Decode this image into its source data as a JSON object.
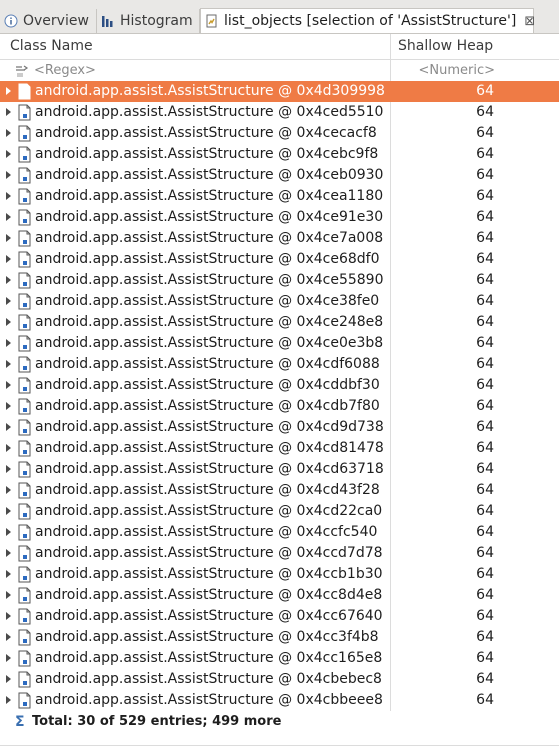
{
  "tabs": [
    {
      "label": "Overview",
      "icon": "info-icon",
      "active": false
    },
    {
      "label": "Histogram",
      "icon": "histogram-icon",
      "active": false
    },
    {
      "label": "list_objects [selection of 'AssistStructure']",
      "icon": "list-objects-icon",
      "active": true,
      "close": "⊠"
    }
  ],
  "columns": {
    "class_name": "Class Name",
    "shallow_heap": "Shallow Heap"
  },
  "filters": {
    "regex": "<Regex>",
    "numeric": "<Numeric>"
  },
  "rows": [
    {
      "name": "android.app.assist.AssistStructure @ 0x4d309998",
      "heap": "64"
    },
    {
      "name": "android.app.assist.AssistStructure @ 0x4ced5510",
      "heap": "64"
    },
    {
      "name": "android.app.assist.AssistStructure @ 0x4cecacf8",
      "heap": "64"
    },
    {
      "name": "android.app.assist.AssistStructure @ 0x4cebc9f8",
      "heap": "64"
    },
    {
      "name": "android.app.assist.AssistStructure @ 0x4ceb0930",
      "heap": "64"
    },
    {
      "name": "android.app.assist.AssistStructure @ 0x4cea1180",
      "heap": "64"
    },
    {
      "name": "android.app.assist.AssistStructure @ 0x4ce91e30",
      "heap": "64"
    },
    {
      "name": "android.app.assist.AssistStructure @ 0x4ce7a008",
      "heap": "64"
    },
    {
      "name": "android.app.assist.AssistStructure @ 0x4ce68df0",
      "heap": "64"
    },
    {
      "name": "android.app.assist.AssistStructure @ 0x4ce55890",
      "heap": "64"
    },
    {
      "name": "android.app.assist.AssistStructure @ 0x4ce38fe0",
      "heap": "64"
    },
    {
      "name": "android.app.assist.AssistStructure @ 0x4ce248e8",
      "heap": "64"
    },
    {
      "name": "android.app.assist.AssistStructure @ 0x4ce0e3b8",
      "heap": "64"
    },
    {
      "name": "android.app.assist.AssistStructure @ 0x4cdf6088",
      "heap": "64"
    },
    {
      "name": "android.app.assist.AssistStructure @ 0x4cddbf30",
      "heap": "64"
    },
    {
      "name": "android.app.assist.AssistStructure @ 0x4cdb7f80",
      "heap": "64"
    },
    {
      "name": "android.app.assist.AssistStructure @ 0x4cd9d738",
      "heap": "64"
    },
    {
      "name": "android.app.assist.AssistStructure @ 0x4cd81478",
      "heap": "64"
    },
    {
      "name": "android.app.assist.AssistStructure @ 0x4cd63718",
      "heap": "64"
    },
    {
      "name": "android.app.assist.AssistStructure @ 0x4cd43f28",
      "heap": "64"
    },
    {
      "name": "android.app.assist.AssistStructure @ 0x4cd22ca0",
      "heap": "64"
    },
    {
      "name": "android.app.assist.AssistStructure @ 0x4ccfc540",
      "heap": "64"
    },
    {
      "name": "android.app.assist.AssistStructure @ 0x4ccd7d78",
      "heap": "64"
    },
    {
      "name": "android.app.assist.AssistStructure @ 0x4ccb1b30",
      "heap": "64"
    },
    {
      "name": "android.app.assist.AssistStructure @ 0x4cc8d4e8",
      "heap": "64"
    },
    {
      "name": "android.app.assist.AssistStructure @ 0x4cc67640",
      "heap": "64"
    },
    {
      "name": "android.app.assist.AssistStructure @ 0x4cc3f4b8",
      "heap": "64"
    },
    {
      "name": "android.app.assist.AssistStructure @ 0x4cc165e8",
      "heap": "64"
    },
    {
      "name": "android.app.assist.AssistStructure @ 0x4cbebec8",
      "heap": "64"
    },
    {
      "name": "android.app.assist.AssistStructure @ 0x4cbbeee8",
      "heap": "64"
    }
  ],
  "selected_row_index": 0,
  "total": {
    "icon": "sigma-icon",
    "text": "Total: 30 of 529 entries; 499 more"
  },
  "colors": {
    "selection": "#ef7b45",
    "tabbar": "#e9e8e6"
  }
}
